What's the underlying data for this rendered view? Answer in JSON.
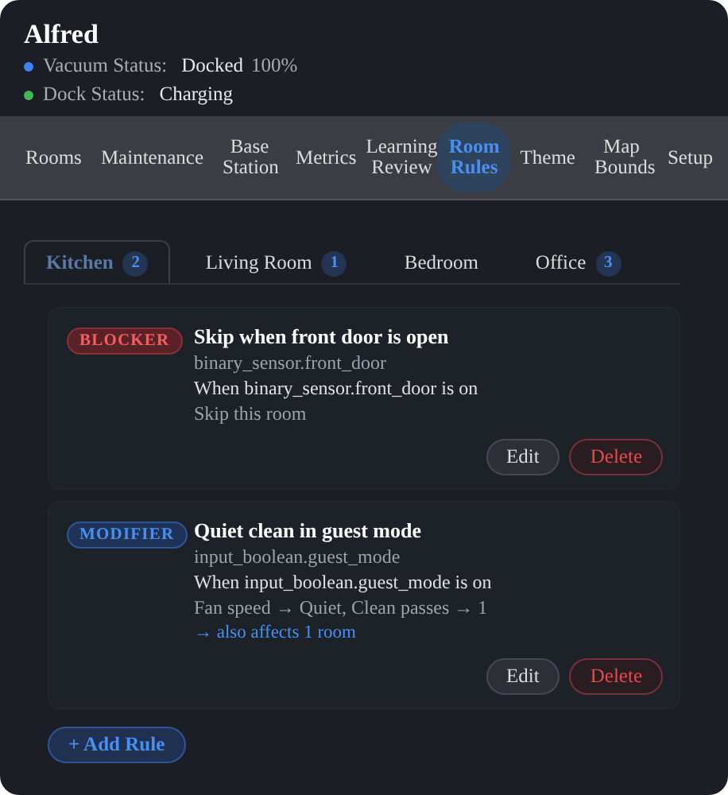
{
  "header": {
    "title": "Alfred",
    "statuses": [
      {
        "label": "Vacuum Status:",
        "value": "Docked",
        "extra": "100%",
        "color": "#3b82f6"
      },
      {
        "label": "Dock Status:",
        "value": "Charging",
        "color": "#3fb950"
      }
    ]
  },
  "nav": [
    {
      "label": "Rooms",
      "selected": false
    },
    {
      "label": "Maintenance",
      "selected": false
    },
    {
      "label": "Base Station",
      "selected": false
    },
    {
      "label": "Metrics",
      "selected": false
    },
    {
      "label": "Learning Review",
      "selected": false
    },
    {
      "label": "Room Rules",
      "selected": true
    },
    {
      "label": "Theme",
      "selected": false
    },
    {
      "label": "Map Bounds",
      "selected": false
    },
    {
      "label": "Setup",
      "selected": false
    }
  ],
  "room_tabs": [
    {
      "label": "Kitchen",
      "count": "2",
      "selected": true
    },
    {
      "label": "Living Room",
      "count": "1",
      "selected": false
    },
    {
      "label": "Bedroom",
      "selected": false
    },
    {
      "label": "Office",
      "count": "3",
      "selected": false
    }
  ],
  "rules": [
    {
      "kind": "blocker",
      "badge": "BLOCKER",
      "title": "Skip when front door is open",
      "entity": "binary_sensor.front_door",
      "condition": "When binary_sensor.front_door is on",
      "action": "Skip this room",
      "buttons": [
        "Edit",
        "Delete"
      ]
    },
    {
      "kind": "modifier",
      "badge": "MODIFIER",
      "title": "Quiet clean in guest mode",
      "entity": "input_boolean.guest_mode",
      "condition": "When input_boolean.guest_mode is on",
      "action": "Fan speed → Quiet, Clean passes → 1",
      "also": "→ also affects 1 room",
      "buttons": [
        "Edit",
        "Delete"
      ]
    }
  ],
  "add_button": "+ Add Rule"
}
